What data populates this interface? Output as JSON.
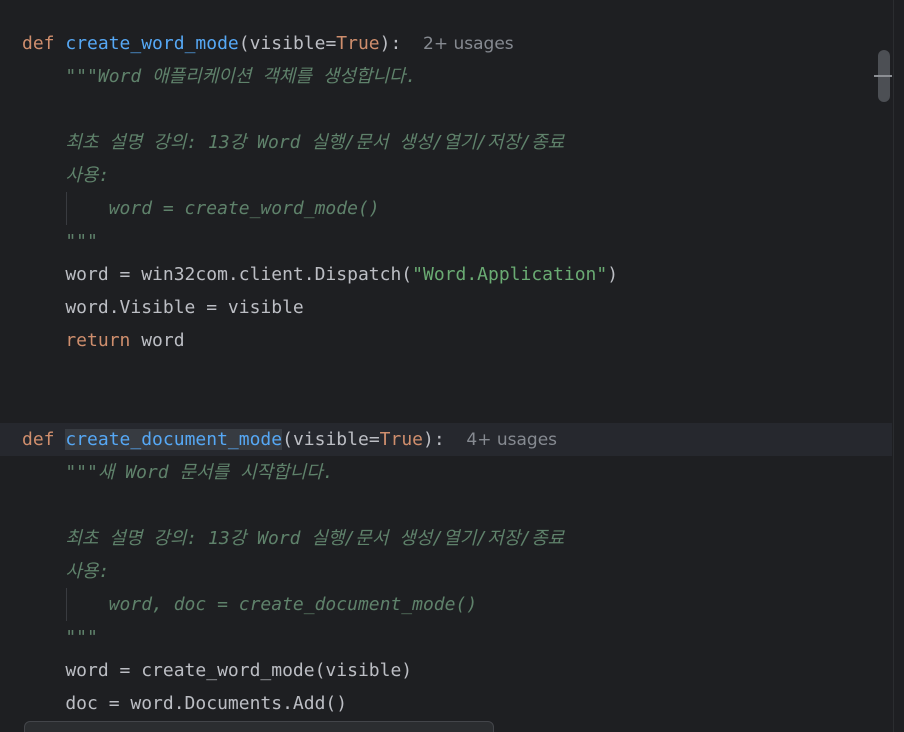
{
  "editor": {
    "lines": {
      "l1": {
        "def": "def",
        "name": "create_word_mode",
        "open": "(",
        "param": "visible",
        "eq": "=",
        "bool": "True",
        "close": "):",
        "hint": "2+ usages"
      },
      "l2": {
        "text": "    \"\"\"Word 애플리케이션 객체를 생성합니다."
      },
      "l4": {
        "text": "    최초 설명 강의: 13강 Word 실행/문서 생성/열기/저장/종료"
      },
      "l5": {
        "text": "    사용:"
      },
      "l6": {
        "text": "        word = create_word_mode()"
      },
      "l7": {
        "text": "    \"\"\""
      },
      "l8": {
        "pre": "    word = win32com.client.Dispatch(",
        "str": "\"Word.Application\"",
        "post": ")"
      },
      "l9": {
        "text": "    word.Visible = visible"
      },
      "l10": {
        "kw": "    return",
        "rest": " word"
      },
      "l13": {
        "def": "def",
        "name": "create_document_mode",
        "open": "(",
        "param": "visible",
        "eq": "=",
        "bool": "True",
        "close": "):",
        "hint": "4+ usages"
      },
      "l14": {
        "text": "    \"\"\"새 Word 문서를 시작합니다."
      },
      "l16": {
        "text": "    최초 설명 강의: 13강 Word 실행/문서 생성/열기/저장/종료"
      },
      "l17": {
        "text": "    사용:"
      },
      "l18": {
        "text": "        word, doc = create_document_mode()"
      },
      "l19": {
        "text": "    \"\"\""
      },
      "l20": {
        "text": "    word = create_word_mode(visible)"
      },
      "l21": {
        "text": "    doc = word.Documents.Add()"
      }
    }
  }
}
